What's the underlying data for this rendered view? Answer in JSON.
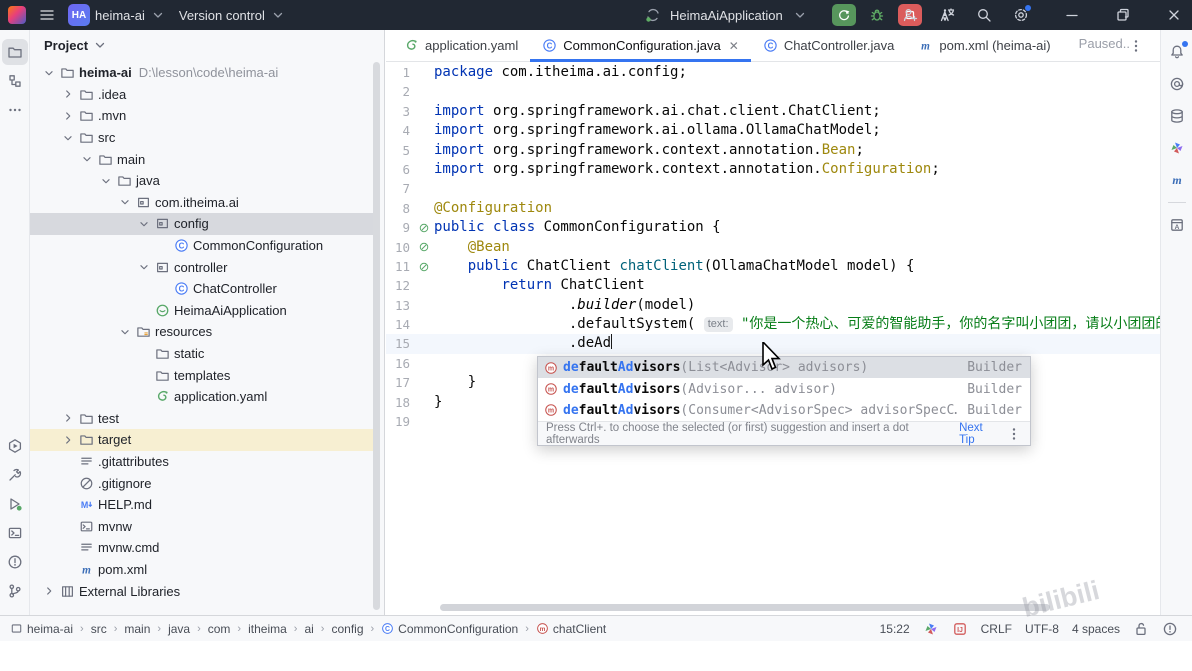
{
  "titlebar": {
    "project_badge": "HA",
    "project_name": "heima-ai",
    "vcs_label": "Version control",
    "run_config": "HeimaAiApplication"
  },
  "panel": {
    "title": "Project"
  },
  "tree": {
    "items": [
      {
        "depth": 0,
        "chev": "down",
        "icon": "folder",
        "label": "heima-ai",
        "bold": true,
        "suffix": "D:\\lesson\\code\\heima-ai"
      },
      {
        "depth": 1,
        "chev": "right",
        "icon": "folder",
        "label": ".idea"
      },
      {
        "depth": 1,
        "chev": "right",
        "icon": "folder",
        "label": ".mvn"
      },
      {
        "depth": 1,
        "chev": "down",
        "icon": "folder",
        "label": "src"
      },
      {
        "depth": 2,
        "chev": "down",
        "icon": "folder",
        "label": "main"
      },
      {
        "depth": 3,
        "chev": "down",
        "icon": "folder",
        "label": "java"
      },
      {
        "depth": 4,
        "chev": "down",
        "icon": "package",
        "label": "com.itheima.ai"
      },
      {
        "depth": 5,
        "chev": "down",
        "icon": "package",
        "label": "config",
        "state": "selected"
      },
      {
        "depth": 6,
        "chev": "none",
        "icon": "class",
        "label": "CommonConfiguration"
      },
      {
        "depth": 5,
        "chev": "down",
        "icon": "package",
        "label": "controller"
      },
      {
        "depth": 6,
        "chev": "none",
        "icon": "class",
        "label": "ChatController"
      },
      {
        "depth": 5,
        "chev": "none",
        "icon": "springboot",
        "label": "HeimaAiApplication"
      },
      {
        "depth": 4,
        "chev": "down",
        "icon": "resources",
        "label": "resources"
      },
      {
        "depth": 5,
        "chev": "none",
        "icon": "folder",
        "label": "static"
      },
      {
        "depth": 5,
        "chev": "none",
        "icon": "folder",
        "label": "templates"
      },
      {
        "depth": 5,
        "chev": "none",
        "icon": "spring",
        "label": "application.yaml"
      },
      {
        "depth": 1,
        "chev": "right",
        "icon": "folder",
        "label": "test"
      },
      {
        "depth": 1,
        "chev": "right",
        "icon": "folder",
        "label": "target",
        "state": "excluded"
      },
      {
        "depth": 1,
        "chev": "none",
        "icon": "textfile",
        "label": ".gitattributes"
      },
      {
        "depth": 1,
        "chev": "none",
        "icon": "ignored",
        "label": ".gitignore"
      },
      {
        "depth": 1,
        "chev": "none",
        "icon": "markdown",
        "label": "HELP.md"
      },
      {
        "depth": 1,
        "chev": "none",
        "icon": "console",
        "label": "mvnw"
      },
      {
        "depth": 1,
        "chev": "none",
        "icon": "textfile",
        "label": "mvnw.cmd"
      },
      {
        "depth": 1,
        "chev": "none",
        "icon": "maven",
        "label": "pom.xml"
      },
      {
        "depth": 0,
        "chev": "right",
        "icon": "library",
        "label": "External Libraries"
      }
    ]
  },
  "tabs": [
    {
      "label": "application.yaml",
      "icon": "spring",
      "active": false,
      "closable": false
    },
    {
      "label": "CommonConfiguration.java",
      "icon": "class",
      "active": true,
      "closable": true
    },
    {
      "label": "ChatController.java",
      "icon": "class",
      "active": false,
      "closable": false
    },
    {
      "label": "pom.xml (heima-ai)",
      "icon": "maven",
      "active": false,
      "closable": false
    }
  ],
  "editor": {
    "paused": "Paused..",
    "lines": [
      {
        "n": 1,
        "tokens": [
          {
            "t": "package ",
            "s": "kw"
          },
          {
            "t": "com.itheima.ai.config;",
            "s": "pl"
          }
        ]
      },
      {
        "n": 2,
        "tokens": []
      },
      {
        "n": 3,
        "tokens": [
          {
            "t": "import ",
            "s": "kw"
          },
          {
            "t": "org.springframework.ai.chat.client.ChatClient;",
            "s": "pl"
          }
        ]
      },
      {
        "n": 4,
        "tokens": [
          {
            "t": "import ",
            "s": "kw"
          },
          {
            "t": "org.springframework.ai.ollama.OllamaChatModel;",
            "s": "pl"
          }
        ]
      },
      {
        "n": 5,
        "tokens": [
          {
            "t": "import ",
            "s": "kw"
          },
          {
            "t": "org.springframework.context.annotation.",
            "s": "pl"
          },
          {
            "t": "Bean",
            "s": "ann"
          },
          {
            "t": ";",
            "s": "pl"
          }
        ]
      },
      {
        "n": 6,
        "tokens": [
          {
            "t": "import ",
            "s": "kw"
          },
          {
            "t": "org.springframework.context.annotation.",
            "s": "pl"
          },
          {
            "t": "Configuration",
            "s": "ann"
          },
          {
            "t": ";",
            "s": "pl"
          }
        ]
      },
      {
        "n": 7,
        "tokens": []
      },
      {
        "n": 8,
        "tokens": [
          {
            "t": "@Configuration",
            "s": "ann"
          }
        ]
      },
      {
        "n": 9,
        "gutter": "bean",
        "tokens": [
          {
            "t": "public class ",
            "s": "kw"
          },
          {
            "t": "CommonConfiguration {",
            "s": "pl"
          }
        ]
      },
      {
        "n": 10,
        "gutter": "bean",
        "tokens": [
          {
            "t": "    ",
            "s": "pl"
          },
          {
            "t": "@Bean",
            "s": "ann"
          }
        ]
      },
      {
        "n": 11,
        "gutter": "bean",
        "tokens": [
          {
            "t": "    ",
            "s": "pl"
          },
          {
            "t": "public ",
            "s": "kw"
          },
          {
            "t": "ChatClient ",
            "s": "pl"
          },
          {
            "t": "chatClient",
            "s": "decl"
          },
          {
            "t": "(OllamaChatModel model) {",
            "s": "pl"
          }
        ]
      },
      {
        "n": 12,
        "tokens": [
          {
            "t": "        ",
            "s": "pl"
          },
          {
            "t": "return ",
            "s": "kw"
          },
          {
            "t": "ChatClient",
            "s": "pl"
          }
        ]
      },
      {
        "n": 13,
        "tokens": [
          {
            "t": "                .",
            "s": "pl"
          },
          {
            "t": "builder",
            "s": "it"
          },
          {
            "t": "(model)",
            "s": "pl"
          }
        ]
      },
      {
        "n": 14,
        "tokens": [
          {
            "t": "                .defaultSystem( ",
            "s": "pl"
          },
          {
            "t": "text:",
            "s": "inlay"
          },
          {
            "t": " \"你是一个热心、可爱的智能助手，你的名字叫小团团，请以小团团的身份和语气回",
            "s": "str"
          }
        ]
      },
      {
        "n": 15,
        "caretLine": true,
        "tokens": [
          {
            "t": "                .deAd",
            "s": "pl"
          },
          {
            "t": "",
            "s": "caret"
          }
        ]
      },
      {
        "n": 16,
        "tokens": []
      },
      {
        "n": 17,
        "tokens": [
          {
            "t": "    }",
            "s": "pl"
          }
        ]
      },
      {
        "n": 18,
        "tokens": [
          {
            "t": "}",
            "s": "pl"
          }
        ]
      },
      {
        "n": 19,
        "tokens": []
      }
    ]
  },
  "popup": {
    "items": [
      {
        "selected": true,
        "segments": [
          {
            "t": "de",
            "s": "m"
          },
          {
            "t": "fault",
            "s": "n"
          },
          {
            "t": "Ad",
            "s": "m"
          },
          {
            "t": "visors",
            "s": "n"
          },
          {
            "t": "(List<Advisor> advisors)",
            "s": "p"
          }
        ],
        "ret": "Builder"
      },
      {
        "selected": false,
        "segments": [
          {
            "t": "de",
            "s": "m"
          },
          {
            "t": "fault",
            "s": "n"
          },
          {
            "t": "Ad",
            "s": "m"
          },
          {
            "t": "visors",
            "s": "n"
          },
          {
            "t": "(Advisor... advisor)",
            "s": "p"
          }
        ],
        "ret": "Builder"
      },
      {
        "selected": false,
        "segments": [
          {
            "t": "de",
            "s": "m"
          },
          {
            "t": "fault",
            "s": "n"
          },
          {
            "t": "Ad",
            "s": "m"
          },
          {
            "t": "visors",
            "s": "n"
          },
          {
            "t": "(Consumer<AdvisorSpec> advisorSpecC…",
            "s": "p"
          }
        ],
        "ret": "Builder"
      }
    ],
    "footer": "Press Ctrl+. to choose the selected (or first) suggestion and insert a dot afterwards",
    "next_tip": "Next Tip"
  },
  "breadcrumbs": [
    {
      "label": "heima-ai",
      "icon": "window"
    },
    {
      "label": "src"
    },
    {
      "label": "main"
    },
    {
      "label": "java"
    },
    {
      "label": "com"
    },
    {
      "label": "itheima"
    },
    {
      "label": "ai"
    },
    {
      "label": "config"
    },
    {
      "label": "CommonConfiguration",
      "icon": "class"
    },
    {
      "label": "chatClient",
      "icon": "method"
    }
  ],
  "statusbar": {
    "time": "15:22",
    "line_ending": "CRLF",
    "encoding": "UTF-8",
    "indent": "4 spaces"
  },
  "colors": {
    "accent": "#3574f0",
    "run_green": "#57965c",
    "stop_red": "#db5c5c",
    "string_green": "#067d17",
    "keyword_blue": "#0033b3",
    "annotation": "#9e880d"
  },
  "watermark": "bilibili"
}
